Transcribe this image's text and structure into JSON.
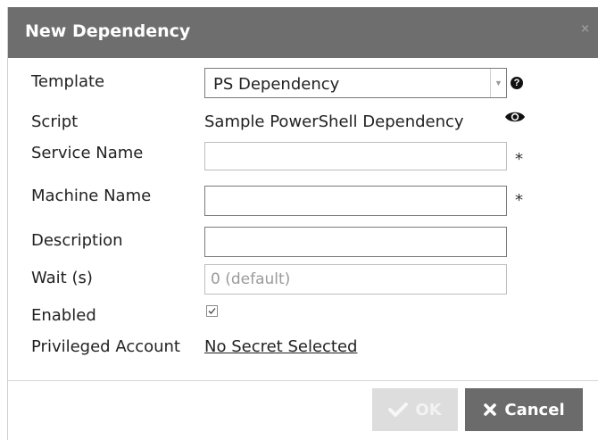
{
  "dialog": {
    "title": "New Dependency",
    "close_glyph": "×"
  },
  "form": {
    "template": {
      "label": "Template",
      "value": "PS Dependency"
    },
    "script": {
      "label": "Script",
      "value": "Sample PowerShell Dependency"
    },
    "service_name": {
      "label": "Service Name",
      "value": "",
      "required_mark": "*"
    },
    "machine_name": {
      "label": "Machine Name",
      "value": "",
      "required_mark": "*"
    },
    "description": {
      "label": "Description",
      "value": ""
    },
    "wait": {
      "label": "Wait (s)",
      "value": "",
      "placeholder": "0 (default)"
    },
    "enabled": {
      "label": "Enabled",
      "checked": true
    },
    "privileged_account": {
      "label": "Privileged Account",
      "value": "No Secret Selected"
    }
  },
  "buttons": {
    "ok_label": "OK",
    "cancel_label": "Cancel"
  },
  "icons": {
    "help": "question-circle-icon",
    "eye": "eye-icon",
    "dropdown": "chevron-down-icon",
    "check": "check-icon",
    "cancel": "x-icon"
  },
  "colors": {
    "titlebar": "#6e6e6e",
    "ok_disabled": "#dddddd",
    "cancel": "#6b6b6b"
  }
}
